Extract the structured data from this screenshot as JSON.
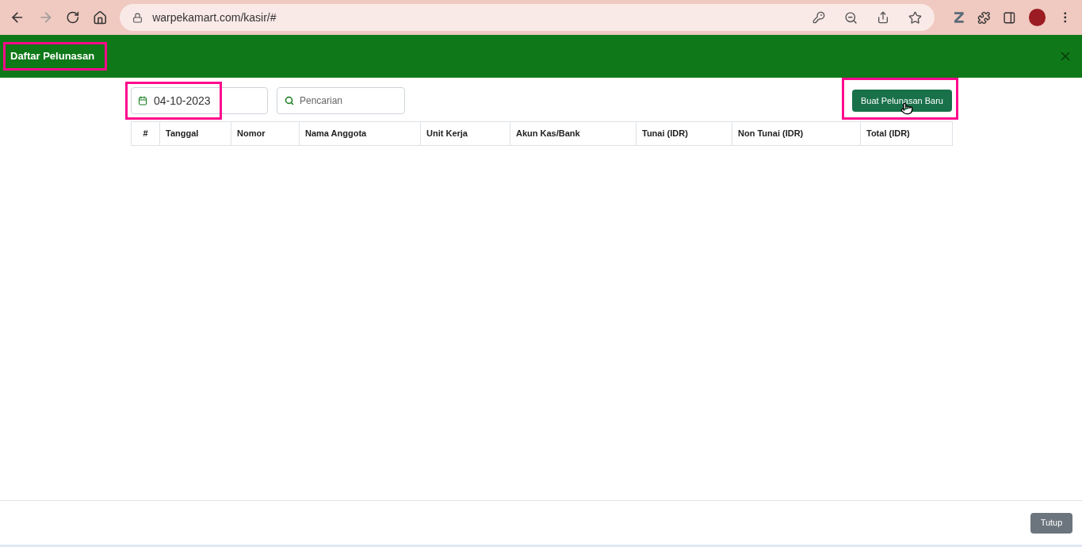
{
  "browser": {
    "url": "warpekamart.com/kasir/#"
  },
  "header": {
    "title": "Daftar Pelunasan"
  },
  "toolbar": {
    "date": "04-10-2023",
    "search": {
      "placeholder": "Pencarian"
    },
    "new_button": "Buat Pelunasan Baru"
  },
  "table": {
    "columns": [
      "#",
      "Tanggal",
      "Nomor",
      "Nama Anggota",
      "Unit Kerja",
      "Akun Kas/Bank",
      "Tunai (IDR)",
      "Non Tunai (IDR)",
      "Total (IDR)"
    ]
  },
  "footer": {
    "button": "Tutup"
  }
}
